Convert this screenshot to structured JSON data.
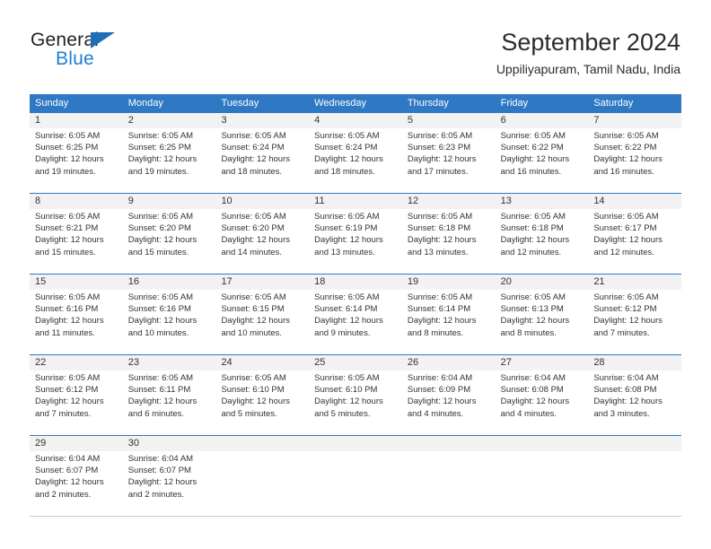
{
  "logo": {
    "top_text": "General",
    "bottom_text": "Blue",
    "triangle_icon": "triangle-icon",
    "brand_blue": "#1f7fd4",
    "triangle_blue": "#1f6fb5"
  },
  "header": {
    "title": "September 2024",
    "subtitle": "Uppiliyapuram, Tamil Nadu, India"
  },
  "theme": {
    "header_row_bg": "#2f78c4",
    "daynum_band_bg": "#f2f2f2",
    "text_color": "#333333"
  },
  "weekdays": [
    "Sunday",
    "Monday",
    "Tuesday",
    "Wednesday",
    "Thursday",
    "Friday",
    "Saturday"
  ],
  "weeks": [
    [
      {
        "day": "1",
        "sunrise": "Sunrise: 6:05 AM",
        "sunset": "Sunset: 6:25 PM",
        "daylight1": "Daylight: 12 hours",
        "daylight2": "and 19 minutes."
      },
      {
        "day": "2",
        "sunrise": "Sunrise: 6:05 AM",
        "sunset": "Sunset: 6:25 PM",
        "daylight1": "Daylight: 12 hours",
        "daylight2": "and 19 minutes."
      },
      {
        "day": "3",
        "sunrise": "Sunrise: 6:05 AM",
        "sunset": "Sunset: 6:24 PM",
        "daylight1": "Daylight: 12 hours",
        "daylight2": "and 18 minutes."
      },
      {
        "day": "4",
        "sunrise": "Sunrise: 6:05 AM",
        "sunset": "Sunset: 6:24 PM",
        "daylight1": "Daylight: 12 hours",
        "daylight2": "and 18 minutes."
      },
      {
        "day": "5",
        "sunrise": "Sunrise: 6:05 AM",
        "sunset": "Sunset: 6:23 PM",
        "daylight1": "Daylight: 12 hours",
        "daylight2": "and 17 minutes."
      },
      {
        "day": "6",
        "sunrise": "Sunrise: 6:05 AM",
        "sunset": "Sunset: 6:22 PM",
        "daylight1": "Daylight: 12 hours",
        "daylight2": "and 16 minutes."
      },
      {
        "day": "7",
        "sunrise": "Sunrise: 6:05 AM",
        "sunset": "Sunset: 6:22 PM",
        "daylight1": "Daylight: 12 hours",
        "daylight2": "and 16 minutes."
      }
    ],
    [
      {
        "day": "8",
        "sunrise": "Sunrise: 6:05 AM",
        "sunset": "Sunset: 6:21 PM",
        "daylight1": "Daylight: 12 hours",
        "daylight2": "and 15 minutes."
      },
      {
        "day": "9",
        "sunrise": "Sunrise: 6:05 AM",
        "sunset": "Sunset: 6:20 PM",
        "daylight1": "Daylight: 12 hours",
        "daylight2": "and 15 minutes."
      },
      {
        "day": "10",
        "sunrise": "Sunrise: 6:05 AM",
        "sunset": "Sunset: 6:20 PM",
        "daylight1": "Daylight: 12 hours",
        "daylight2": "and 14 minutes."
      },
      {
        "day": "11",
        "sunrise": "Sunrise: 6:05 AM",
        "sunset": "Sunset: 6:19 PM",
        "daylight1": "Daylight: 12 hours",
        "daylight2": "and 13 minutes."
      },
      {
        "day": "12",
        "sunrise": "Sunrise: 6:05 AM",
        "sunset": "Sunset: 6:18 PM",
        "daylight1": "Daylight: 12 hours",
        "daylight2": "and 13 minutes."
      },
      {
        "day": "13",
        "sunrise": "Sunrise: 6:05 AM",
        "sunset": "Sunset: 6:18 PM",
        "daylight1": "Daylight: 12 hours",
        "daylight2": "and 12 minutes."
      },
      {
        "day": "14",
        "sunrise": "Sunrise: 6:05 AM",
        "sunset": "Sunset: 6:17 PM",
        "daylight1": "Daylight: 12 hours",
        "daylight2": "and 12 minutes."
      }
    ],
    [
      {
        "day": "15",
        "sunrise": "Sunrise: 6:05 AM",
        "sunset": "Sunset: 6:16 PM",
        "daylight1": "Daylight: 12 hours",
        "daylight2": "and 11 minutes."
      },
      {
        "day": "16",
        "sunrise": "Sunrise: 6:05 AM",
        "sunset": "Sunset: 6:16 PM",
        "daylight1": "Daylight: 12 hours",
        "daylight2": "and 10 minutes."
      },
      {
        "day": "17",
        "sunrise": "Sunrise: 6:05 AM",
        "sunset": "Sunset: 6:15 PM",
        "daylight1": "Daylight: 12 hours",
        "daylight2": "and 10 minutes."
      },
      {
        "day": "18",
        "sunrise": "Sunrise: 6:05 AM",
        "sunset": "Sunset: 6:14 PM",
        "daylight1": "Daylight: 12 hours",
        "daylight2": "and 9 minutes."
      },
      {
        "day": "19",
        "sunrise": "Sunrise: 6:05 AM",
        "sunset": "Sunset: 6:14 PM",
        "daylight1": "Daylight: 12 hours",
        "daylight2": "and 8 minutes."
      },
      {
        "day": "20",
        "sunrise": "Sunrise: 6:05 AM",
        "sunset": "Sunset: 6:13 PM",
        "daylight1": "Daylight: 12 hours",
        "daylight2": "and 8 minutes."
      },
      {
        "day": "21",
        "sunrise": "Sunrise: 6:05 AM",
        "sunset": "Sunset: 6:12 PM",
        "daylight1": "Daylight: 12 hours",
        "daylight2": "and 7 minutes."
      }
    ],
    [
      {
        "day": "22",
        "sunrise": "Sunrise: 6:05 AM",
        "sunset": "Sunset: 6:12 PM",
        "daylight1": "Daylight: 12 hours",
        "daylight2": "and 7 minutes."
      },
      {
        "day": "23",
        "sunrise": "Sunrise: 6:05 AM",
        "sunset": "Sunset: 6:11 PM",
        "daylight1": "Daylight: 12 hours",
        "daylight2": "and 6 minutes."
      },
      {
        "day": "24",
        "sunrise": "Sunrise: 6:05 AM",
        "sunset": "Sunset: 6:10 PM",
        "daylight1": "Daylight: 12 hours",
        "daylight2": "and 5 minutes."
      },
      {
        "day": "25",
        "sunrise": "Sunrise: 6:05 AM",
        "sunset": "Sunset: 6:10 PM",
        "daylight1": "Daylight: 12 hours",
        "daylight2": "and 5 minutes."
      },
      {
        "day": "26",
        "sunrise": "Sunrise: 6:04 AM",
        "sunset": "Sunset: 6:09 PM",
        "daylight1": "Daylight: 12 hours",
        "daylight2": "and 4 minutes."
      },
      {
        "day": "27",
        "sunrise": "Sunrise: 6:04 AM",
        "sunset": "Sunset: 6:08 PM",
        "daylight1": "Daylight: 12 hours",
        "daylight2": "and 4 minutes."
      },
      {
        "day": "28",
        "sunrise": "Sunrise: 6:04 AM",
        "sunset": "Sunset: 6:08 PM",
        "daylight1": "Daylight: 12 hours",
        "daylight2": "and 3 minutes."
      }
    ],
    [
      {
        "day": "29",
        "sunrise": "Sunrise: 6:04 AM",
        "sunset": "Sunset: 6:07 PM",
        "daylight1": "Daylight: 12 hours",
        "daylight2": "and 2 minutes."
      },
      {
        "day": "30",
        "sunrise": "Sunrise: 6:04 AM",
        "sunset": "Sunset: 6:07 PM",
        "daylight1": "Daylight: 12 hours",
        "daylight2": "and 2 minutes."
      },
      {
        "day": "",
        "sunrise": "",
        "sunset": "",
        "daylight1": "",
        "daylight2": ""
      },
      {
        "day": "",
        "sunrise": "",
        "sunset": "",
        "daylight1": "",
        "daylight2": ""
      },
      {
        "day": "",
        "sunrise": "",
        "sunset": "",
        "daylight1": "",
        "daylight2": ""
      },
      {
        "day": "",
        "sunrise": "",
        "sunset": "",
        "daylight1": "",
        "daylight2": ""
      },
      {
        "day": "",
        "sunrise": "",
        "sunset": "",
        "daylight1": "",
        "daylight2": ""
      }
    ]
  ]
}
